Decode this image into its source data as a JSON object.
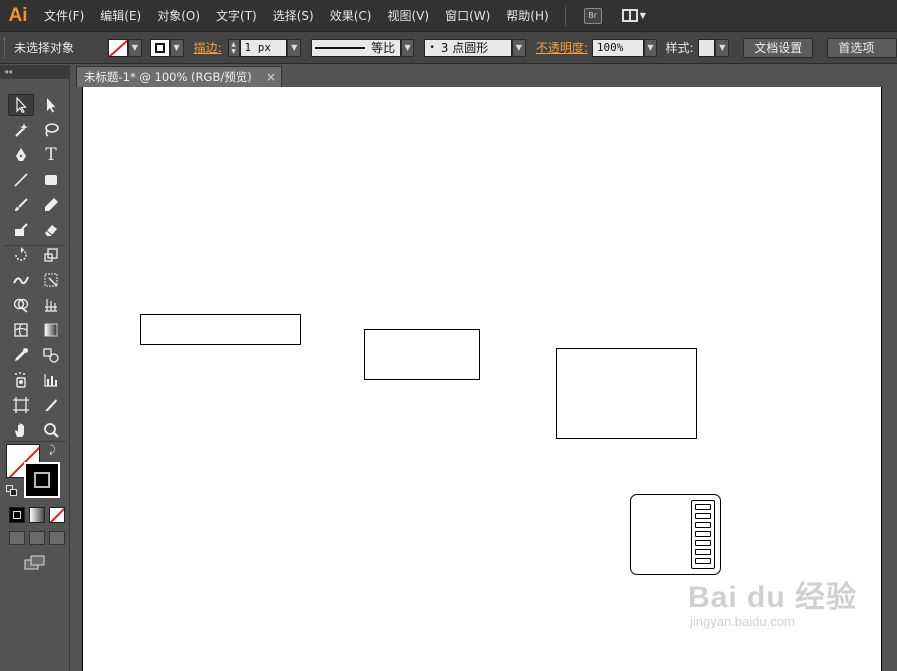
{
  "app": {
    "logo": "Ai"
  },
  "menu": [
    "文件(F)",
    "编辑(E)",
    "对象(O)",
    "文字(T)",
    "选择(S)",
    "效果(C)",
    "视图(V)",
    "窗口(W)",
    "帮助(H)"
  ],
  "bridge_label": "Br",
  "control": {
    "selection": "未选择对象",
    "stroke_label": "描边:",
    "stroke_value": "1 px",
    "profile_label": "等比",
    "brush_label": "3 点圆形",
    "brush_dot": "•",
    "opacity_label": "不透明度:",
    "opacity_value": "100%",
    "style_label": "样式:",
    "doc_setup": "文档设置",
    "prefs": "首选项"
  },
  "toolbar_collapse": "◂◂",
  "document": {
    "tab_title": "未标题-1* @ 100% (RGB/预览)",
    "close": "×"
  },
  "icons": {
    "tools": [
      "selection-icon",
      "direct-selection-icon",
      "magic-wand-icon",
      "lasso-icon",
      "pen-icon",
      "type-icon",
      "line-icon",
      "rectangle-icon",
      "paintbrush-icon",
      "pencil-icon",
      "blob-brush-icon",
      "eraser-icon",
      "rotate-icon",
      "scale-icon",
      "width-icon",
      "free-transform-icon",
      "shape-builder-icon",
      "perspective-grid-icon",
      "mesh-icon",
      "gradient-icon",
      "eyedropper-icon",
      "blend-icon",
      "symbol-sprayer-icon",
      "column-graph-icon",
      "artboard-icon",
      "slice-icon",
      "hand-icon",
      "zoom-icon"
    ]
  },
  "watermark": {
    "brand": "Bai du 经验",
    "url": "jingyan.baidu.com"
  }
}
